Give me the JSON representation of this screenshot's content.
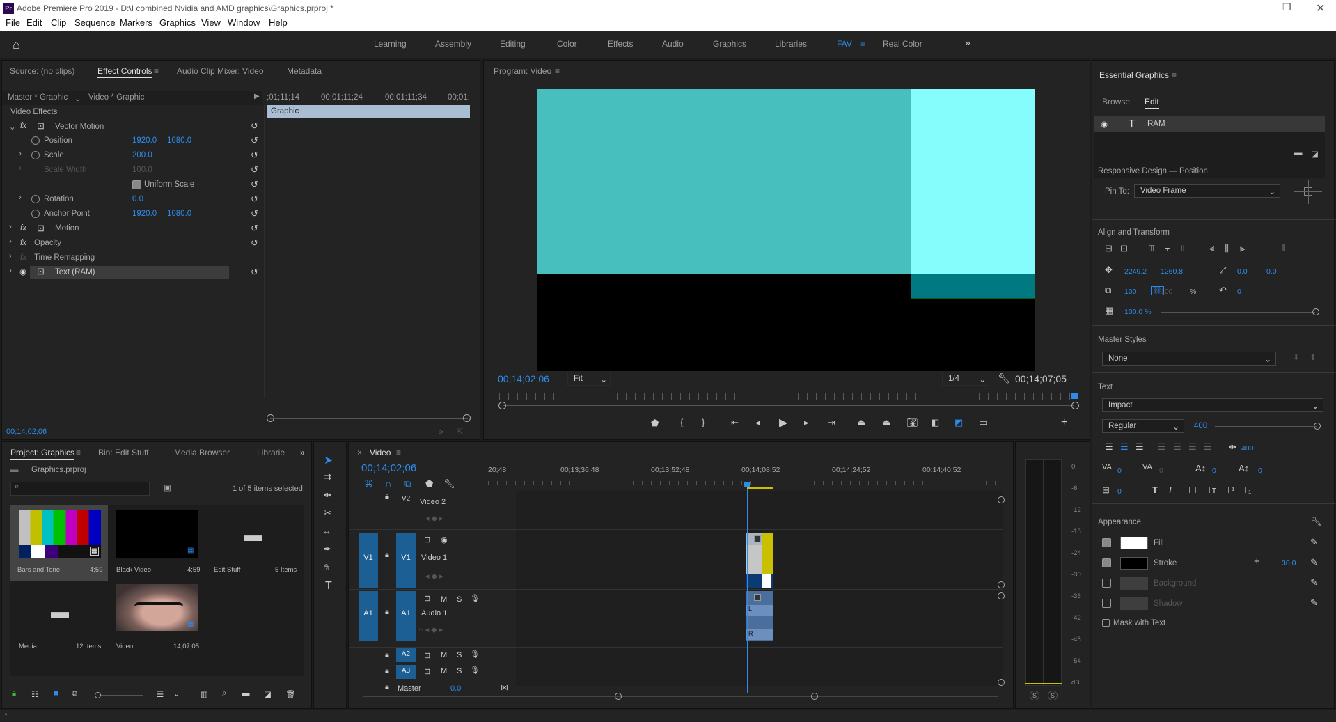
{
  "title": "Adobe Premiere Pro 2019 - D:\\I combined Nvidia and AMD graphics\\Graphics.prproj *",
  "app_icon": "Pr",
  "menu": [
    "File",
    "Edit",
    "Clip",
    "Sequence",
    "Markers",
    "Graphics",
    "View",
    "Window",
    "Help"
  ],
  "workspaces": [
    "Learning",
    "Assembly",
    "Editing",
    "Color",
    "Effects",
    "Audio",
    "Graphics",
    "Libraries",
    "FAV",
    "Real Color"
  ],
  "active_workspace": "FAV",
  "source_tabs": [
    "Source: (no clips)",
    "Effect Controls",
    "Audio Clip Mixer: Video",
    "Metadata"
  ],
  "effect_controls": {
    "master": "Master * Graphic",
    "clip": "Video * Graphic",
    "timecodes": [
      ";01;11;14",
      "00;01;11;24",
      "00;01;11;34",
      "00;01;"
    ],
    "clip_bar": "Graphic",
    "section": "Video Effects",
    "vector_motion": "Vector Motion",
    "position_label": "Position",
    "position_x": "1920.0",
    "position_y": "1080.0",
    "scale_label": "Scale",
    "scale_val": "200.0",
    "scale_width_label": "Scale Width",
    "scale_width_val": "100.0",
    "uniform_label": "Uniform Scale",
    "rotation_label": "Rotation",
    "rotation_val": "0.0",
    "anchor_label": "Anchor Point",
    "anchor_x": "1920.0",
    "anchor_y": "1080.0",
    "motion": "Motion",
    "opacity": "Opacity",
    "time_remap": "Time Remapping",
    "text_layer": "Text (RAM)",
    "timecode": "00;14;02;06"
  },
  "program": {
    "title": "Program: Video",
    "timecode": "00;14;02;06",
    "fit": "Fit",
    "quality": "1/4",
    "duration": "00;14;07;05"
  },
  "essential_graphics": {
    "title": "Essential Graphics",
    "tabs": [
      "Browse",
      "Edit"
    ],
    "layer": "RAM",
    "responsive_title": "Responsive Design — Position",
    "pin_to_label": "Pin To:",
    "pin_to": "Video Frame",
    "align_title": "Align and Transform",
    "pos_x": "2249.2",
    "pos_y": "1260.8",
    "anchor_x": "0.0",
    "anchor_y": "0.0",
    "scale": "100",
    "scale2": "100",
    "pct": "%",
    "rotation": "0",
    "opacity": "100.0 %",
    "master_styles": "Master Styles",
    "style": "None",
    "text_title": "Text",
    "font": "Impact",
    "weight": "Regular",
    "size": "400",
    "leading": "400",
    "kerning": "0",
    "tracking": "0",
    "baseline": "0",
    "tsume": "0",
    "tab_width": "0",
    "appearance": "Appearance",
    "fill": "Fill",
    "stroke": "Stroke",
    "stroke_width": "30.0",
    "background": "Background",
    "shadow": "Shadow",
    "mask": "Mask with Text"
  },
  "project": {
    "tabs": [
      "Project: Graphics",
      "Bin: Edit Stuff",
      "Media Browser",
      "Librarie"
    ],
    "file": "Graphics.prproj",
    "selected": "1 of 5 items selected",
    "items": [
      {
        "name": "Bars and Tone",
        "meta": "4;59"
      },
      {
        "name": "Black Video",
        "meta": "4;59"
      },
      {
        "name": "Edit Stuff",
        "meta": "5 Items"
      },
      {
        "name": "Media",
        "meta": "12 Items"
      },
      {
        "name": "Video",
        "meta": "14;07;05"
      }
    ]
  },
  "timeline": {
    "tab": "Video",
    "timecode": "00;14;02;06",
    "ruler": [
      "20;48",
      "00;13;36;48",
      "00;13;52;48",
      "00;14;08;52",
      "00;14;24;52",
      "00;14;40;52"
    ],
    "v2": "V2",
    "v2_name": "Video 2",
    "v1": "V1",
    "v1_name": "Video 1",
    "a1": "A1",
    "a1_name": "Audio 1",
    "a2": "A2",
    "a3": "A3",
    "master": "Master",
    "master_val": "0.0"
  },
  "meter": {
    "labels": [
      "0",
      "-6",
      "-12",
      "-18",
      "-24",
      "-30",
      "-36",
      "-42",
      "-48",
      "-54",
      "dB"
    ],
    "solo": [
      "S",
      "S"
    ]
  }
}
